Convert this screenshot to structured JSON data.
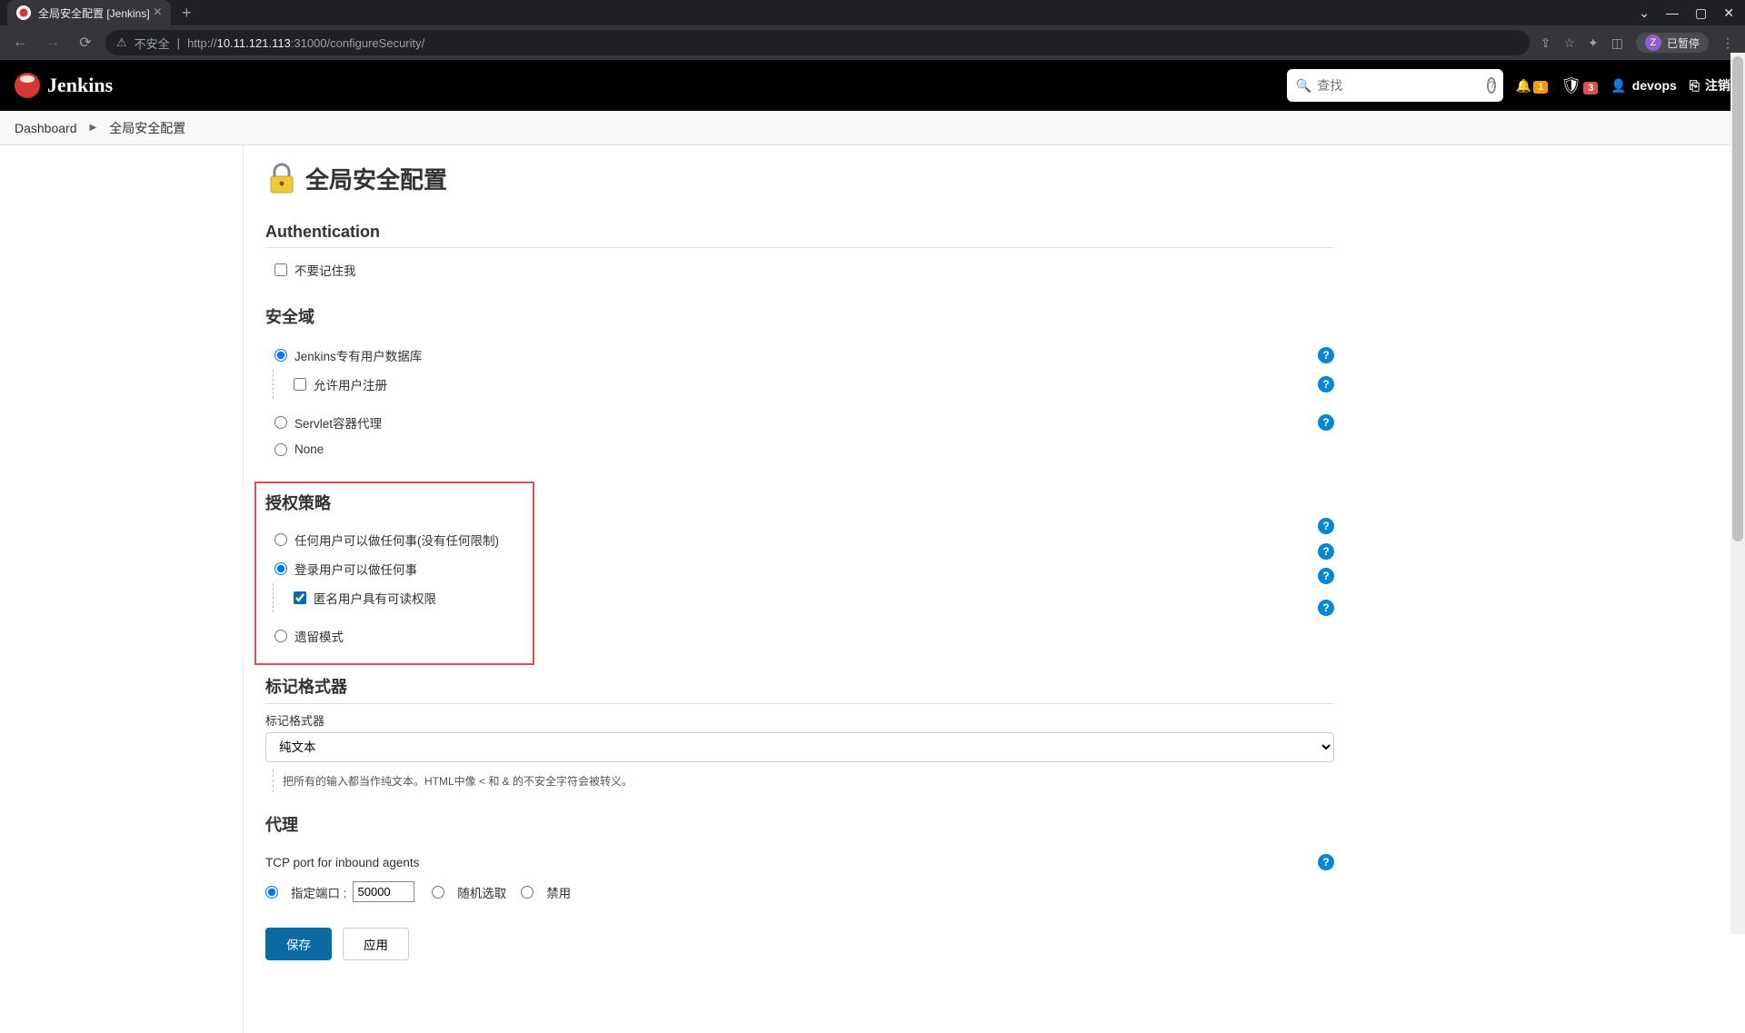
{
  "browser": {
    "tab_title": "全局安全配置 [Jenkins]",
    "insecure_label": "不安全",
    "url_prefix": "http://",
    "url_host": "10.11.121.113",
    "url_path": ":31000/configureSecurity/",
    "paused_label": "已暂停",
    "avatar_letter": "Z"
  },
  "header": {
    "brand": "Jenkins",
    "search_placeholder": "查找",
    "notif_badge": "1",
    "alert_badge": "3",
    "username": "devops",
    "logout_label": "注销"
  },
  "breadcrumb": {
    "dashboard": "Dashboard",
    "current": "全局安全配置"
  },
  "page": {
    "title": "全局安全配置"
  },
  "auth": {
    "section_title": "Authentication",
    "remember_me_label": "不要记住我"
  },
  "realm": {
    "section_title": "安全域",
    "jenkins_db_label": "Jenkins专有用户数据库",
    "allow_signup_label": "允许用户注册",
    "servlet_label": "Servlet容器代理",
    "none_label": "None"
  },
  "authz": {
    "section_title": "授权策略",
    "anyone_label": "任何用户可以做任何事(没有任何限制)",
    "logged_in_label": "登录用户可以做任何事",
    "anon_read_label": "匿名用户具有可读权限",
    "legacy_label": "遗留模式"
  },
  "markup": {
    "section_title": "标记格式器",
    "field_label": "标记格式器",
    "selected": "纯文本",
    "desc": "把所有的输入都当作纯文本。HTML中像 < 和 & 的不安全字符会被转义。"
  },
  "agent": {
    "section_title": "代理",
    "tcp_label": "TCP port for inbound agents",
    "fixed_label": "指定端口 :",
    "port_value": "50000",
    "random_label": "随机选取",
    "disable_label": "禁用"
  },
  "buttons": {
    "save": "保存",
    "apply": "应用"
  }
}
